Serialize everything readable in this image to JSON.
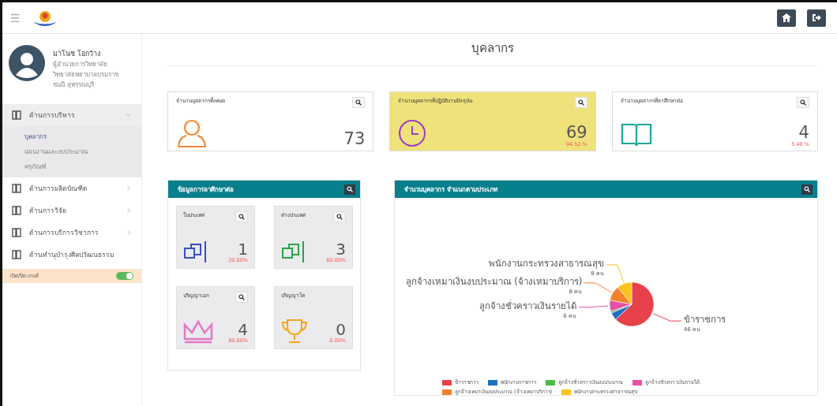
{
  "topbar": {
    "menu_glyph": "☰"
  },
  "user": {
    "name": "มาโนช โอกว้าง",
    "lines": [
      "ผู้อำนวยการวิทยาลัย",
      "วิทยาลัยพยาบาลบรมราช",
      "ชนนี สุพรรณบุรี"
    ]
  },
  "sidebar": {
    "items": [
      {
        "label": "ด้านการบริหาร",
        "selected": true,
        "expanded": true,
        "children": [
          {
            "label": "บุคลากร",
            "selected": true
          },
          {
            "label": "แผนงานและงบประมาณ",
            "selected": false
          },
          {
            "label": "ครุภัณฑ์",
            "selected": false
          }
        ]
      },
      {
        "label": "ด้านการผลิตบัณฑิต",
        "selected": false,
        "expanded": false
      },
      {
        "label": "ด้านการวิจัย",
        "selected": false,
        "expanded": false
      },
      {
        "label": "ด้านการบริการวิชาการ",
        "selected": false,
        "expanded": false
      },
      {
        "label": "ด้านทำนุบำรุงศิลปวัฒนธรรม",
        "selected": false
      }
    ],
    "toggle": {
      "label": "เปิด/ปิด เกมส์",
      "on": true
    }
  },
  "page_title": "บุคลากร",
  "stat_cards": [
    {
      "title": "จำนวนบุคลากรทั้งหมด",
      "value": "73",
      "kind": "person",
      "highlighted": false
    },
    {
      "title": "จำนวนบุคลากรที่ปฏิบัติงานปัจจุบัน",
      "value": "69",
      "percent": "94.52 %",
      "kind": "clock",
      "highlighted": true
    },
    {
      "title": "จำนวนบุคลากรที่ลาศึกษาต่อ",
      "value": "4",
      "percent": "5.48 %",
      "kind": "book",
      "highlighted": false
    }
  ],
  "study_panel": {
    "title": "ข้อมูลการลาศึกษาต่อ",
    "cards": [
      {
        "title": "ในประเทศ",
        "value": "1",
        "percent": "20.00%",
        "kind": "flag",
        "color": "#3b4fc4",
        "has_search": true
      },
      {
        "title": "ต่างประเทศ",
        "value": "3",
        "percent": "60.00%",
        "kind": "flag",
        "color": "#27a34a",
        "has_search": true
      },
      {
        "title": "ปริญญาเอก",
        "value": "4",
        "percent": "80.00%",
        "kind": "crown",
        "color": "#e07ac4",
        "has_search": true
      },
      {
        "title": "ปริญญาโท",
        "value": "0",
        "percent": "0.00%",
        "kind": "trophy",
        "color": "#f5a31a",
        "has_search": false
      }
    ]
  },
  "chart_panel": {
    "title": "จำนวนบุคลากร จำแนกตามประเภท",
    "chart_data": {
      "type": "pie",
      "categories": [
        "ข้าราชการ",
        "พนักงานราชการ",
        "ลูกจ้างชั่วคราวเงินงบประมาณ",
        "ลูกจ้างชั่วคราวเงินรายได้",
        "ลูกจ้างเหมาเงินงบประมาณ (จ้างเหมาบริการ)",
        "พนักงานกระทรวงสาธารณสุข"
      ],
      "series": [
        {
          "colors": [
            "#e8414b",
            "#1f6fc2",
            "#4cbb47",
            "#e84fa6",
            "#f4802a",
            "#fcc31e"
          ],
          "values": [
            63.0,
            5.5,
            1.3,
            8.2,
            11.0,
            11.0
          ]
        }
      ],
      "value_labels": [
        "46 คน",
        null,
        null,
        "6 คน",
        "8 คน",
        "8 คน"
      ],
      "legend": true
    }
  }
}
